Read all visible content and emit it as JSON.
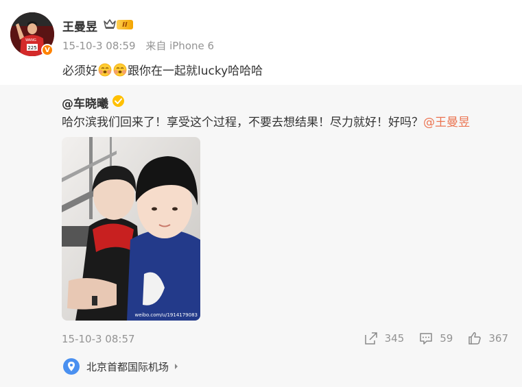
{
  "post": {
    "author": {
      "name": "王曼昱",
      "level_badge": "II",
      "avatar_jersey_number": "225"
    },
    "time": "15-10-3 08:59",
    "source": "来自 iPhone 6",
    "text_before": "必须好",
    "text_after": "跟你在一起就lucky哈哈哈",
    "emoji_icon": "face-holding-back-tears-icon"
  },
  "repost": {
    "author": "@车晓曦",
    "text": "哈尔滨我们回来了！享受这个过程，不要去想结果！尽力就好！好吗？",
    "mention": "@王曼昱",
    "photo_watermark": "weibo.com/u/1914179083",
    "time": "15-10-3 08:57",
    "actions": {
      "reposts": "345",
      "comments": "59",
      "likes": "367"
    },
    "location": "北京首都国际机场"
  },
  "colors": {
    "accent": "#ff8200",
    "mention": "#eb7350",
    "meta": "#939393",
    "repost_bg": "#f7f7f7",
    "location_icon": "#4a90f0"
  }
}
